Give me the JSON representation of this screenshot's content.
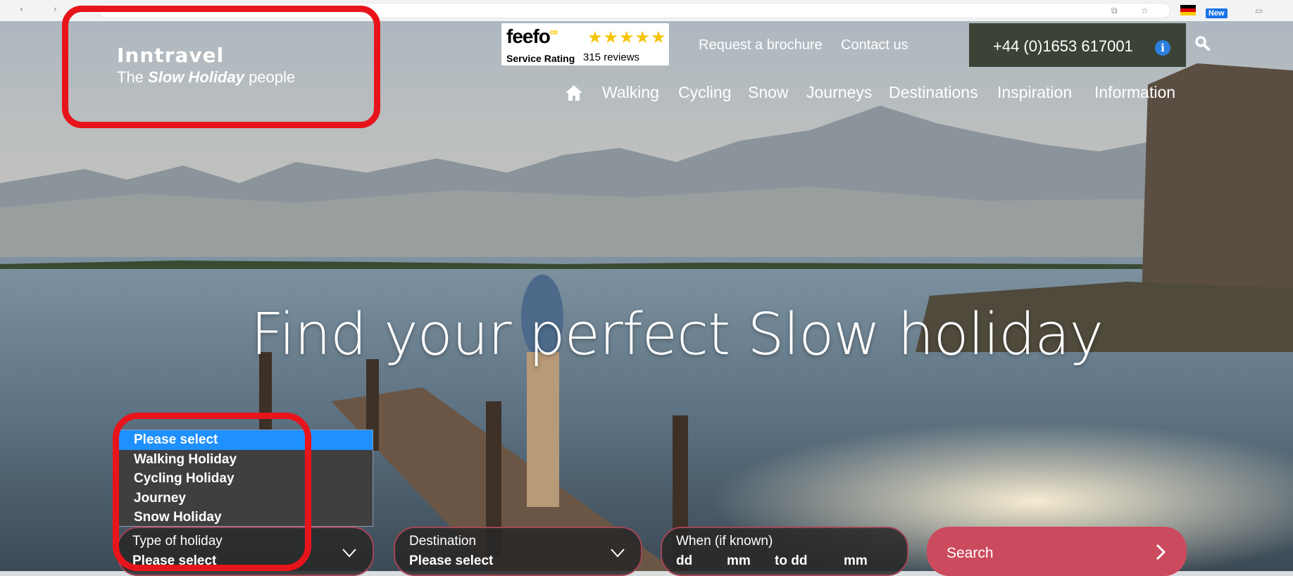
{
  "logo": {
    "brand": "Inntravel",
    "tag_pre": "The ",
    "tag_em": "Slow Holiday",
    "tag_post": " people"
  },
  "feefo": {
    "name": "feefo",
    "stars": "★★★★★",
    "rating_label": "Service Rating",
    "reviews": "315 reviews"
  },
  "header": {
    "links": [
      "Request a brochure",
      "Contact us"
    ],
    "phone": "+44 (0)1653 617001",
    "info_glyph": "i"
  },
  "nav": {
    "items": [
      "Walking",
      "Cycling",
      "Snow",
      "Journeys",
      "Destinations",
      "Inspiration",
      "Information"
    ]
  },
  "hero": {
    "headline": "Find your perfect Slow holiday"
  },
  "dropdown": {
    "options": [
      "Please select",
      "Walking Holiday",
      "Cycling Holiday",
      "Journey",
      "Snow Holiday"
    ],
    "selected_index": 0
  },
  "search_form": {
    "type": {
      "label": "Type of holiday",
      "value": "Please select"
    },
    "destination": {
      "label": "Destination",
      "value": "Please select"
    },
    "when": {
      "label": "When (if known)",
      "dd": "dd",
      "mm": "mm",
      "to": "to dd",
      "mm2": "mm"
    },
    "search_label": "Search"
  },
  "chrome": {
    "badge": "New"
  },
  "colors": {
    "highlight": "#e8141b",
    "search_button": "#cc4a5d",
    "phone_box": "#3b4336",
    "dropdown_selected": "#1e90ff"
  },
  "icons": [
    "search-icon",
    "home-icon",
    "info-icon",
    "chevron-down-icon",
    "chevron-right-icon"
  ]
}
